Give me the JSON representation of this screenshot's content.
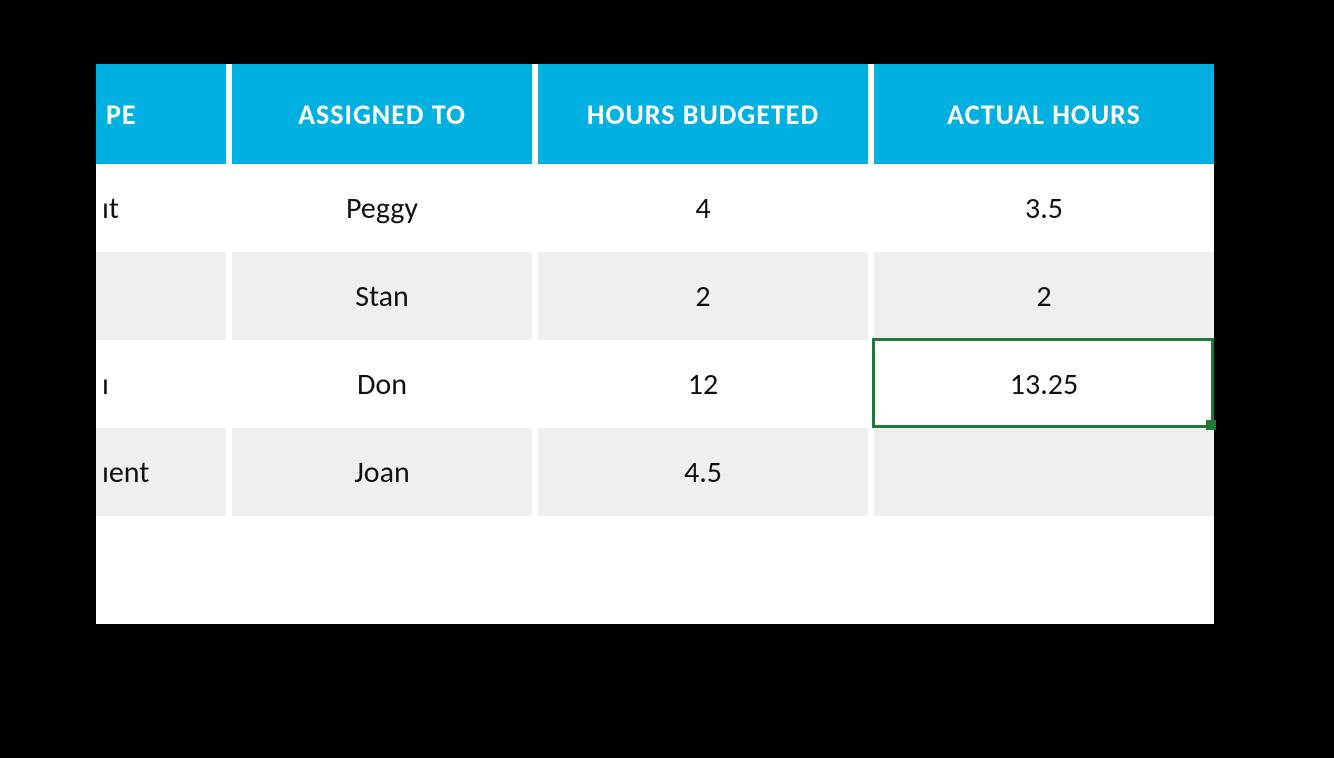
{
  "colors": {
    "header_bg": "#00b0e0",
    "header_fg": "#ffffff",
    "row_alt": "#efefef",
    "selection": "#1f7a3a"
  },
  "table": {
    "headers": {
      "type_partial": "PE",
      "assigned": "ASSIGNED TO",
      "budgeted": "HOURS BUDGETED",
      "actual": "ACTUAL HOURS"
    },
    "rows": [
      {
        "type_partial": "ıt",
        "assigned": "Peggy",
        "budgeted": "4",
        "actual": "3.5"
      },
      {
        "type_partial": "",
        "assigned": "Stan",
        "budgeted": "2",
        "actual": "2"
      },
      {
        "type_partial": "ı",
        "assigned": "Don",
        "budgeted": "12",
        "actual": "13.25"
      },
      {
        "type_partial": "ıent",
        "assigned": "Joan",
        "budgeted": "4.5",
        "actual": ""
      }
    ]
  },
  "selection": {
    "row_index": 2,
    "col": "actual"
  }
}
